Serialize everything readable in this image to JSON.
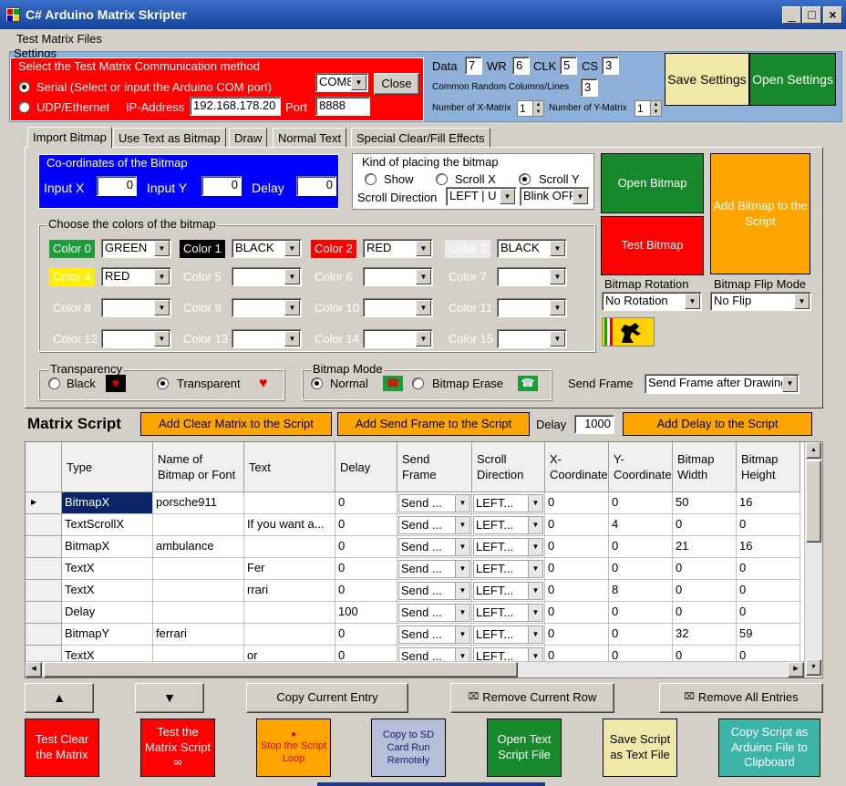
{
  "title": "C# Arduino Matrix Skripter",
  "window": {
    "minimize": "_",
    "maximize": "□",
    "close": "×"
  },
  "menu": {
    "test_matrix_files": "Test Matrix Files"
  },
  "settings": {
    "legend": "Settings",
    "comm_legend": "Select the Test Matrix Communication method",
    "serial_label": "Serial (Select or input the Arduino COM port)",
    "com_value": "COM8",
    "close_label": "Close",
    "udp_label": "UDP/Ethernet",
    "ip_label": "IP-Address",
    "ip_value": "192.168.178.20",
    "port_label": "Port",
    "port_value": "8888",
    "data_label": "Data",
    "data_value": "7",
    "wr_label": "WR",
    "wr_value": "6",
    "clk_label": "CLK",
    "clk_value": "5",
    "cs_label": "CS",
    "cs_value": "3",
    "crc_label": "Common Random Columns/Lines",
    "crc_value": "3",
    "num_x_label": "Number of X-Matrix",
    "num_x_value": "1",
    "num_y_label": "Number of Y-Matrix",
    "num_y_value": "1",
    "save_label": "Save Settings",
    "open_label": "Open Settings"
  },
  "tabs": [
    "Import Bitmap",
    "Use Text as Bitmap",
    "Draw",
    "Normal Text",
    "Special Clear/Fill Effects"
  ],
  "coords": {
    "legend": "Co-ordinates of the Bitmap",
    "input_x_label": "Input X",
    "input_x_value": "0",
    "input_y_label": "Input Y",
    "input_y_value": "0",
    "delay_label": "Delay",
    "delay_value": "0"
  },
  "placing": {
    "legend": "Kind of placing the bitmap",
    "show": "Show",
    "scroll_x": "Scroll X",
    "scroll_y": "Scroll Y",
    "direction_label": "Scroll Direction",
    "direction_value": "LEFT | U",
    "blink_value": "Blink OFF"
  },
  "bitmap_buttons": {
    "open": "Open Bitmap",
    "test": "Test Bitmap",
    "add": "Add Bitmap to the Script",
    "rotation_label": "Bitmap Rotation",
    "rotation_value": "No Rotation",
    "flip_label": "Bitmap Flip Mode",
    "flip_value": "No Flip"
  },
  "colors": {
    "legend": "Choose the colors of the bitmap",
    "items": [
      {
        "label": "Color 0",
        "value": "GREEN"
      },
      {
        "label": "Color 1",
        "value": "BLACK"
      },
      {
        "label": "Color 2",
        "value": "RED"
      },
      {
        "label": "Color 3",
        "value": "BLACK"
      },
      {
        "label": "Color 4",
        "value": "RED"
      },
      {
        "label": "Color 5",
        "value": ""
      },
      {
        "label": "Color 6",
        "value": ""
      },
      {
        "label": "Color 7",
        "value": ""
      },
      {
        "label": "Color 8",
        "value": ""
      },
      {
        "label": "Color 9",
        "value": ""
      },
      {
        "label": "Color 10",
        "value": ""
      },
      {
        "label": "Color 11",
        "value": ""
      },
      {
        "label": "Color 12",
        "value": ""
      },
      {
        "label": "Color 13",
        "value": ""
      },
      {
        "label": "Color 14",
        "value": ""
      },
      {
        "label": "Color 15",
        "value": ""
      }
    ]
  },
  "transparency": {
    "legend": "Transparency",
    "black": "Black",
    "transparent": "Transparent"
  },
  "bitmap_mode": {
    "legend": "Bitmap Mode",
    "normal": "Normal",
    "erase": "Bitmap Erase"
  },
  "send_frame": {
    "label": "Send Frame",
    "value": "Send Frame after Drawing"
  },
  "script": {
    "title": "Matrix Script",
    "add_clear": "Add Clear Matrix to the Script",
    "add_send": "Add Send Frame to the Script",
    "delay_label": "Delay",
    "delay_value": "1000",
    "add_delay": "Add Delay to the Script"
  },
  "grid": {
    "headers": [
      "Type",
      "Name of Bitmap or Font",
      "Text",
      "Delay",
      "Send Frame",
      "Scroll Direction",
      "X-Coordinate",
      "Y-Coordinate",
      "Bitmap Width",
      "Bitmap Height"
    ],
    "rows": [
      {
        "type": "BitmapX",
        "name": "porsche911",
        "text": "",
        "delay": "0",
        "send": "Send ...",
        "scroll": "LEFT...",
        "x": "0",
        "y": "0",
        "w": "50",
        "h": "16"
      },
      {
        "type": "TextScrollX",
        "name": "",
        "text": "If you want a...",
        "delay": "0",
        "send": "Send ...",
        "scroll": "LEFT...",
        "x": "0",
        "y": "4",
        "w": "0",
        "h": "0"
      },
      {
        "type": "BitmapX",
        "name": "ambulance",
        "text": "",
        "delay": "0",
        "send": "Send ...",
        "scroll": "LEFT...",
        "x": "0",
        "y": "0",
        "w": "21",
        "h": "16"
      },
      {
        "type": "TextX",
        "name": "",
        "text": "Fer",
        "delay": "0",
        "send": "Send ...",
        "scroll": "LEFT...",
        "x": "0",
        "y": "0",
        "w": "0",
        "h": "0"
      },
      {
        "type": "TextX",
        "name": "",
        "text": "rrari",
        "delay": "0",
        "send": "Send ...",
        "scroll": "LEFT...",
        "x": "0",
        "y": "8",
        "w": "0",
        "h": "0"
      },
      {
        "type": "Delay",
        "name": "",
        "text": "",
        "delay": "100",
        "send": "Send ...",
        "scroll": "LEFT...",
        "x": "0",
        "y": "0",
        "w": "0",
        "h": "0"
      },
      {
        "type": "BitmapY",
        "name": "ferrari",
        "text": "",
        "delay": "0",
        "send": "Send ...",
        "scroll": "LEFT...",
        "x": "0",
        "y": "0",
        "w": "32",
        "h": "59"
      },
      {
        "type": "TextX",
        "name": "",
        "text": "or",
        "delay": "0",
        "send": "Send ...",
        "scroll": "LEFT...",
        "x": "0",
        "y": "0",
        "w": "0",
        "h": "0"
      }
    ]
  },
  "bottom": {
    "up": "▲",
    "down": "▼",
    "copy_entry": "Copy Current Entry",
    "remove_row": "Remove Current Row",
    "remove_all": "Remove All Entries",
    "test_clear": "Test Clear the Matrix",
    "test_script": "Test the Matrix Script ∞",
    "stop_loop": "Stop the Script Loop",
    "copy_sd": "Copy to SD Card Run Remotely",
    "open_text": "Open Text Script File",
    "save_text": "Save Script as Text File",
    "copy_clip": "Copy Script as Arduino File to Clipboard"
  }
}
